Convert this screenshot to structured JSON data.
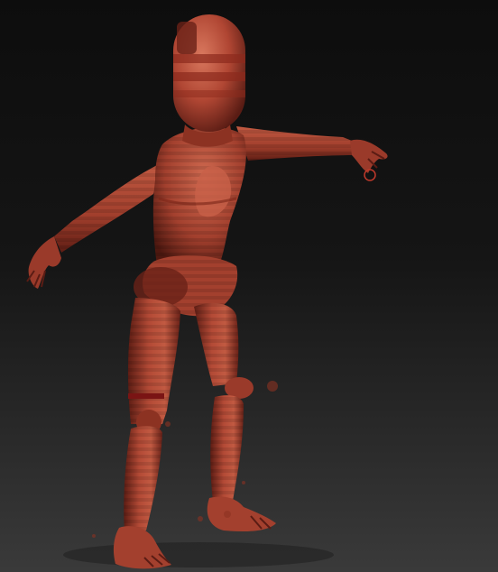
{
  "viewport": {
    "background_top": "#0d0d0d",
    "background_bottom": "#3a3a3a"
  },
  "model": {
    "material_color": "#b84a36",
    "shadow_color": "#5a1c14",
    "highlight_color": "#d9785e",
    "band_color": "#8c2a1c",
    "seam_color": "#7a1414",
    "brush_cursor_color": "#c0392b"
  }
}
